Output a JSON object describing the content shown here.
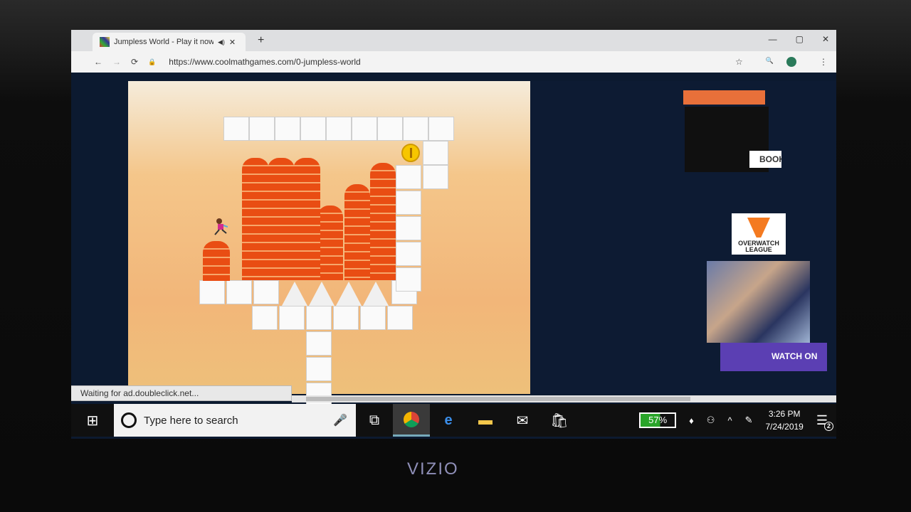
{
  "browser": {
    "tab_title": "Jumpless World - Play it now",
    "new_tab": "+",
    "url": "https://www.coolmathgames.com/0-jumpless-world",
    "back": "←",
    "forward": "→",
    "reload": "⟳",
    "minimize": "—",
    "maximize": "▢",
    "close": "✕",
    "tab_close": "✕",
    "mute": "◀)",
    "lock": "🔒",
    "bookmark": "☆",
    "zoom": "🔍",
    "menu": "⋮"
  },
  "status_bar": {
    "text": "Waiting for ad.doubleclick.net..."
  },
  "ads": {
    "button": "BOOK",
    "logo_text": "OVERWATCH LEAGUE",
    "banner": "WATCH ON"
  },
  "taskbar": {
    "start": "⊞",
    "search_placeholder": "Type here to search",
    "mic": "🎤",
    "icons": [
      "task-view",
      "chrome",
      "edge",
      "file-explorer",
      "mail",
      "store"
    ],
    "battery": "57%",
    "battery_level": 57,
    "time": "3:26 PM",
    "date": "7/24/2019",
    "notifications": "2",
    "tray_chevron": "^"
  },
  "monitor": {
    "brand": "VIZIO"
  }
}
